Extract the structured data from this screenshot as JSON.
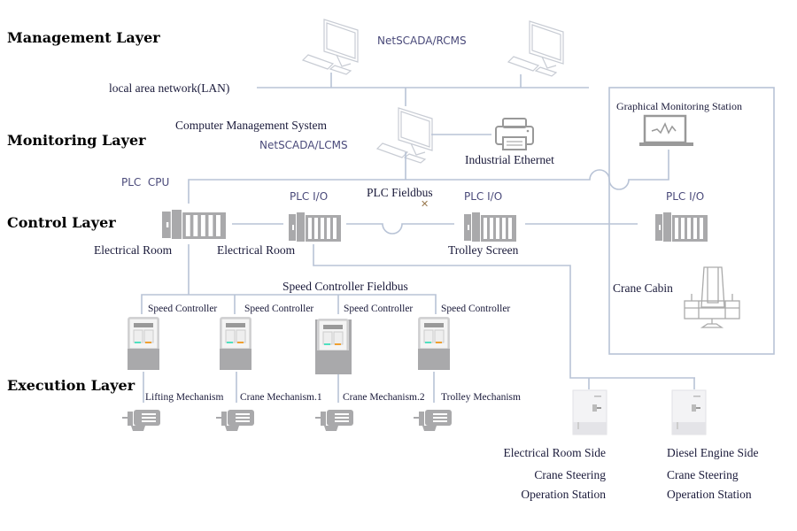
{
  "layers": {
    "management": "Management Layer",
    "monitoring": "Monitoring Layer",
    "control": "Control Layer",
    "execution": "Execution Layer"
  },
  "management": {
    "server_label": "NetSCADA/RCMS",
    "lan_label": "local area network(LAN)"
  },
  "monitoring": {
    "cms_label": "Computer Management System",
    "cms_software": "NetSCADA/LCMS",
    "printer_label": "Industrial Ethernet",
    "graphical_station": "Graphical Monitoring Station"
  },
  "control": {
    "plc_cpu": "PLC  CPU",
    "fieldbus": "PLC Fieldbus",
    "plc_io": [
      "PLC I/O",
      "PLC I/O",
      "PLC I/O"
    ],
    "locations": [
      "Electrical Room",
      "Electrical Room",
      "Trolley Screen"
    ],
    "crane_cabin": "Crane Cabin"
  },
  "execution": {
    "sc_fieldbus": "Speed Controller Fieldbus",
    "speed_controllers": [
      "Speed Controller",
      "Speed Controller",
      "Speed Controller",
      "Speed Controller"
    ],
    "mechanisms": [
      "Lifting Mechanism",
      "Crane Mechanism.1",
      "Crane Mechanism.2",
      "Trolley Mechanism"
    ],
    "stations": [
      {
        "line1": "Electrical Room Side",
        "line2": "Crane Steering",
        "line3": "Operation Station"
      },
      {
        "line1": "Diesel Engine Side",
        "line2": "Crane Steering",
        "line3": "Operation Station"
      }
    ]
  },
  "colors": {
    "line": "#b8c3d6",
    "device": "#a9a9ab",
    "fault_mark": "#9a7a50",
    "led_green": "#4fe0c0",
    "led_orange": "#f0a030"
  }
}
